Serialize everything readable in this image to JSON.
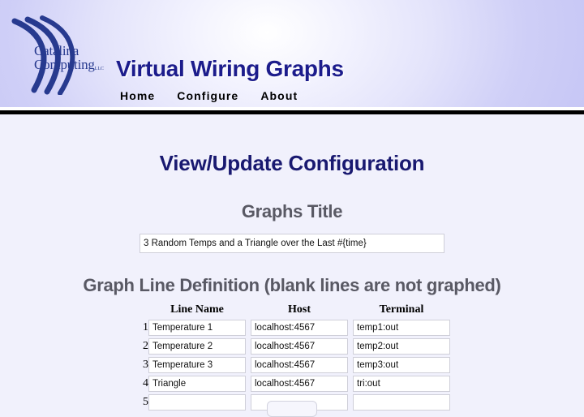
{
  "header": {
    "logo": {
      "name": "catalina-computing-logo",
      "line1": "Catalina",
      "line2": "Computing",
      "suffix": "LLC",
      "arc_color": "#273a8f"
    },
    "title": "Virtual Wiring Graphs",
    "title_color": "#1c1c8c",
    "nav": [
      {
        "label": "Home",
        "name": "nav-home"
      },
      {
        "label": "Configure",
        "name": "nav-configure"
      },
      {
        "label": "About",
        "name": "nav-about"
      }
    ]
  },
  "main": {
    "page_title": "View/Update Configuration",
    "page_title_color": "#191970",
    "graphs_title": {
      "heading": "Graphs Title",
      "value": "3 Random Temps and a Triangle over the Last #{time}",
      "placeholder": ""
    },
    "line_definition": {
      "heading": "Graph Line Definition (blank lines are not graphed)",
      "columns": [
        "Line Name",
        "Host",
        "Terminal"
      ],
      "rows": [
        {
          "index": "1",
          "name": "Temperature 1",
          "host": "localhost:4567",
          "terminal": "temp1:out"
        },
        {
          "index": "2",
          "name": "Temperature 2",
          "host": "localhost:4567",
          "terminal": "temp2:out"
        },
        {
          "index": "3",
          "name": "Temperature 3",
          "host": "localhost:4567",
          "terminal": "temp3:out"
        },
        {
          "index": "4",
          "name": "Triangle",
          "host": "localhost:4567",
          "terminal": "tri:out"
        },
        {
          "index": "5",
          "name": "",
          "host": "",
          "terminal": ""
        }
      ]
    },
    "submit_label": ""
  },
  "theme": {
    "body_background": "#f1f1fc",
    "header_gradient_light": "#ffffff",
    "header_gradient_dark": "#c6c6f5",
    "heading_gray": "#595964",
    "input_border": "#cfcfd9"
  }
}
